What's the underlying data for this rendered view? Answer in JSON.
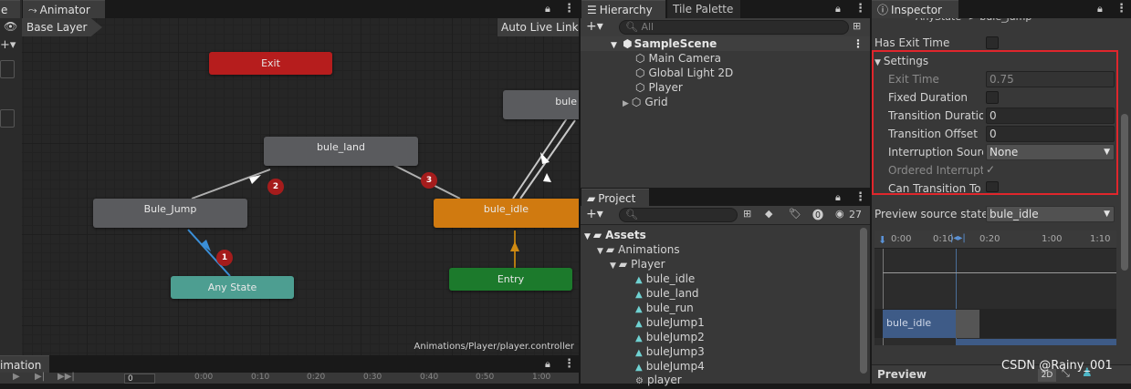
{
  "animator": {
    "tab_label": "Animator",
    "layer_label": "Base Layer",
    "live_link_label": "Auto Live Link",
    "footer_path": "Animations/Player/player.controller",
    "nodes": {
      "exit": "Exit",
      "bule_land": "bule_land",
      "bule_jump": "Bule_Jump",
      "bule_idle": "bule_idle",
      "any_state": "Any State",
      "entry": "Entry",
      "bule_partial": "bule"
    },
    "badges": [
      "1",
      "2",
      "3"
    ],
    "left_tab_partial": "e",
    "colors": {
      "exit": "#b61d1d",
      "default_state": "#5a5b5e",
      "idle": "#d07a10",
      "any_state": "#4d9e91",
      "entry": "#1c7a2c"
    }
  },
  "animation_tab": {
    "label": "imation",
    "frame_value": "0",
    "ruler": [
      "0:00",
      "0:10",
      "0:20",
      "0:30",
      "0:40",
      "0:50",
      "1:00"
    ]
  },
  "hierarchy": {
    "tab_label": "Hierarchy",
    "tile_palette_label": "Tile Palette",
    "search_placeholder": "All",
    "scene": "SampleScene",
    "items": [
      "Main Camera",
      "Global Light 2D",
      "Player",
      "Grid"
    ]
  },
  "project": {
    "tab_label": "Project",
    "count_label": "27",
    "tree": {
      "assets": "Assets",
      "animations": "Animations",
      "player": "Player",
      "files": [
        "bule_idle",
        "bule_land",
        "bule_run",
        "buleJump1",
        "buleJump2",
        "buleJump3",
        "buleJump4",
        "player"
      ]
    }
  },
  "inspector": {
    "tab_label": "Inspector",
    "header_partial": "AnyState -> bule_jump",
    "has_exit_time_label": "Has Exit Time",
    "settings_label": "Settings",
    "rows": {
      "exit_time": {
        "label": "Exit Time",
        "value": "0.75"
      },
      "fixed_duration": {
        "label": "Fixed Duration"
      },
      "transition_duration": {
        "label": "Transition Duration",
        "value": "0"
      },
      "transition_offset": {
        "label": "Transition Offset",
        "value": "0"
      },
      "interruption_source": {
        "label": "Interruption Source",
        "value": "None"
      },
      "ordered_interruption": {
        "label": "Ordered Interruption",
        "check": "✓"
      },
      "can_transition_to_self": {
        "label": "Can Transition To Self"
      }
    },
    "preview_source_label": "Preview source state",
    "preview_source_value": "bule_idle",
    "timeline_ticks": [
      "0:00",
      "0:10",
      "0:20",
      "1:00",
      "1:10"
    ],
    "timeline_clip": "bule_idle",
    "preview_label": "Preview",
    "mode_2d": "2D",
    "highlight_color": "#e0262c"
  },
  "watermark": "CSDN @Rainy_001"
}
